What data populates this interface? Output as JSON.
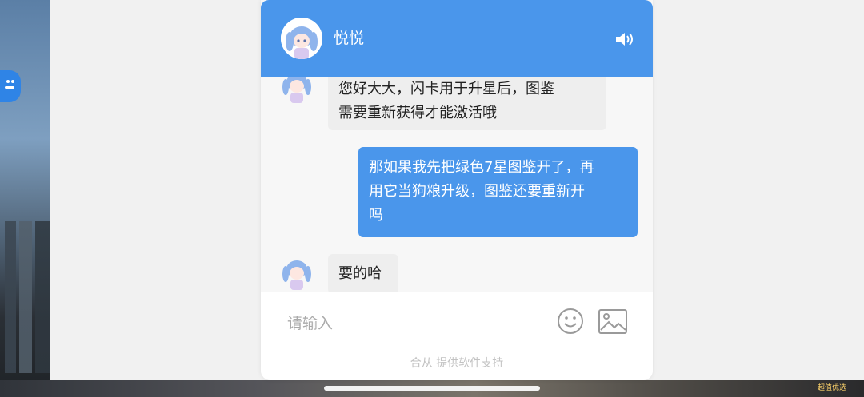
{
  "chat": {
    "title": "悦悦",
    "messages": [
      {
        "from": "agent",
        "lines": [
          "您好大大，闪卡用于升星后，图鉴",
          "需要重新获得才能激活哦"
        ]
      },
      {
        "from": "user",
        "lines": [
          "那如果我先把绿色7星图鉴开了，再",
          "用它当狗粮升级，图鉴还要重新开",
          "吗"
        ]
      },
      {
        "from": "agent",
        "lines": [
          "要的哈"
        ]
      }
    ],
    "input_placeholder": "请输入",
    "footer": "合从 提供软件支持"
  },
  "colors": {
    "header": "#4a96eb",
    "user_bubble": "#4a96eb",
    "agent_bubble": "#eeeeee"
  },
  "background_game": {
    "bottom_text": "超值优选"
  }
}
